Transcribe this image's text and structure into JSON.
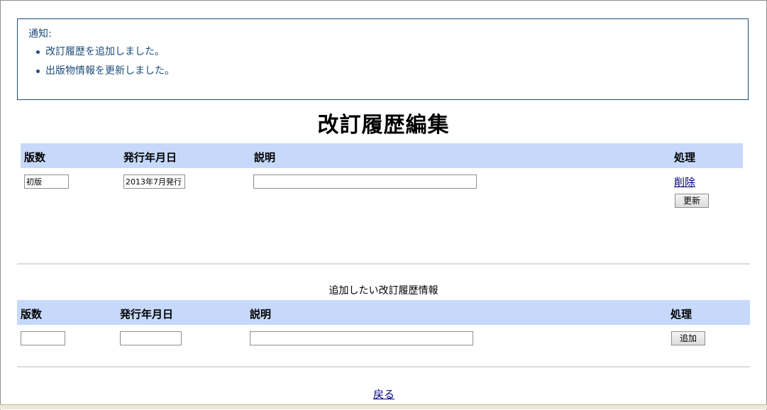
{
  "notice": {
    "title": "通知:",
    "items": [
      "改訂履歴を追加しました。",
      "出版物情報を更新しました。"
    ]
  },
  "page_title": "改訂履歴編集",
  "edit_table": {
    "headers": [
      "版数",
      "発行年月日",
      "説明",
      "処理"
    ],
    "row": {
      "edition": "初版",
      "date": "2013年7月発行",
      "description": "",
      "delete_label": "削除",
      "update_label": "更新"
    }
  },
  "add_section": {
    "title": "追加したい改訂履歴情報",
    "headers": [
      "版数",
      "発行年月日",
      "説明",
      "処理"
    ],
    "edition": "",
    "date": "",
    "description": "",
    "add_label": "追加"
  },
  "back_label": "戻る"
}
